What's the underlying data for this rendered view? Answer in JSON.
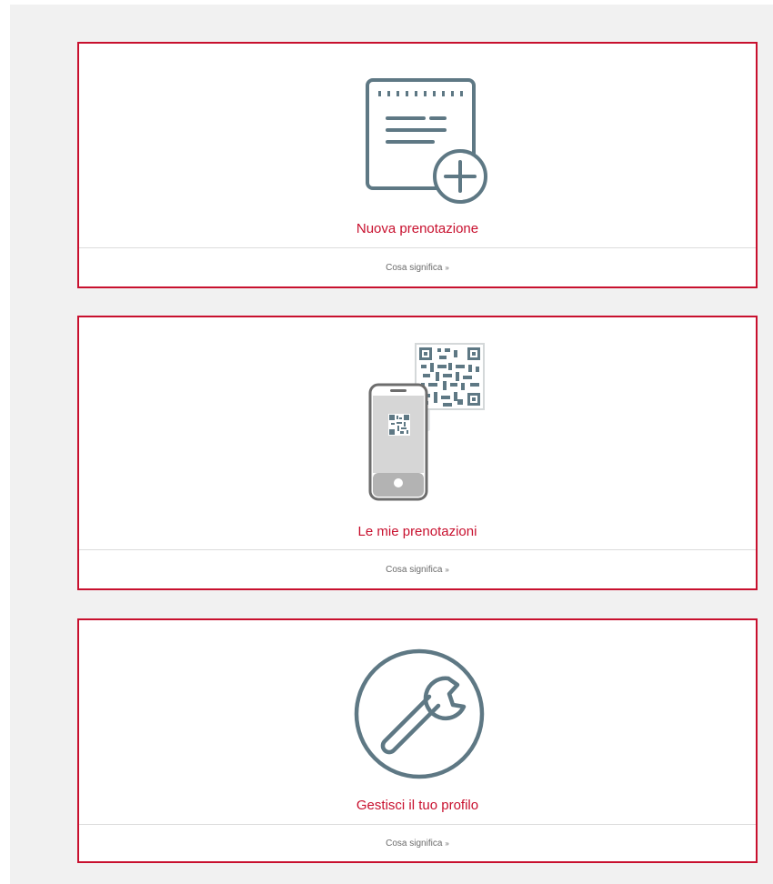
{
  "colors": {
    "accent": "#c8102e",
    "icon": "#5e7884",
    "background": "#f1f1f1"
  },
  "cards": [
    {
      "title": "Nuova prenotazione",
      "footer_label": "Cosa significa",
      "footer_icon": "chevron-double-down-icon",
      "icon": "calendar-add-icon"
    },
    {
      "title": "Le mie prenotazioni",
      "footer_label": "Cosa significa",
      "footer_icon": "chevron-double-down-icon",
      "icon": "phone-qr-code-icon"
    },
    {
      "title": "Gestisci il tuo profilo",
      "footer_label": "Cosa significa",
      "footer_icon": "chevron-double-down-icon",
      "icon": "wrench-icon"
    }
  ]
}
